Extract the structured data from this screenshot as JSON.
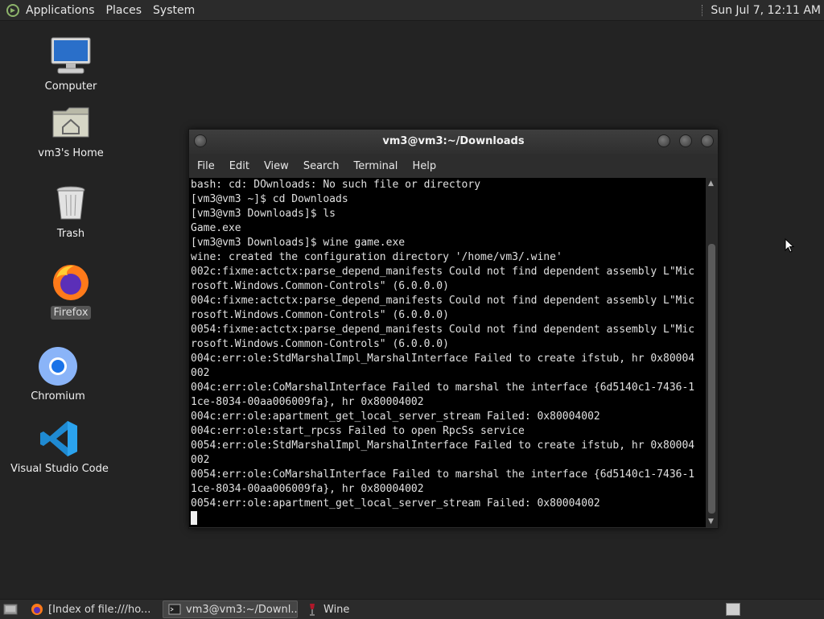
{
  "top_panel": {
    "menus": [
      "Applications",
      "Places",
      "System"
    ],
    "clock": "Sun Jul  7, 12:11 AM"
  },
  "desktop": {
    "icons": [
      {
        "label": "Computer",
        "icon": "computer-icon"
      },
      {
        "label": "vm3's Home",
        "icon": "home-folder-icon"
      },
      {
        "label": "Trash",
        "icon": "trash-icon"
      },
      {
        "label": "Firefox",
        "icon": "firefox-icon",
        "selected": true
      },
      {
        "label": "Chromium",
        "icon": "chromium-icon"
      },
      {
        "label": "Visual Studio Code",
        "icon": "vscode-icon"
      }
    ]
  },
  "terminal": {
    "title": "vm3@vm3:~/Downloads",
    "menu": [
      "File",
      "Edit",
      "View",
      "Search",
      "Terminal",
      "Help"
    ],
    "lines": [
      "bash: cd: DOwnloads: No such file or directory",
      "[vm3@vm3 ~]$ cd Downloads",
      "[vm3@vm3 Downloads]$ ls",
      "Game.exe",
      "[vm3@vm3 Downloads]$ wine game.exe",
      "wine: created the configuration directory '/home/vm3/.wine'",
      "002c:fixme:actctx:parse_depend_manifests Could not find dependent assembly L\"Mic",
      "rosoft.Windows.Common-Controls\" (6.0.0.0)",
      "004c:fixme:actctx:parse_depend_manifests Could not find dependent assembly L\"Mic",
      "rosoft.Windows.Common-Controls\" (6.0.0.0)",
      "0054:fixme:actctx:parse_depend_manifests Could not find dependent assembly L\"Mic",
      "rosoft.Windows.Common-Controls\" (6.0.0.0)",
      "004c:err:ole:StdMarshalImpl_MarshalInterface Failed to create ifstub, hr 0x80004",
      "002",
      "004c:err:ole:CoMarshalInterface Failed to marshal the interface {6d5140c1-7436-1",
      "1ce-8034-00aa006009fa}, hr 0x80004002",
      "004c:err:ole:apartment_get_local_server_stream Failed: 0x80004002",
      "004c:err:ole:start_rpcss Failed to open RpcSs service",
      "0054:err:ole:StdMarshalImpl_MarshalInterface Failed to create ifstub, hr 0x80004",
      "002",
      "0054:err:ole:CoMarshalInterface Failed to marshal the interface {6d5140c1-7436-1",
      "1ce-8034-00aa006009fa}, hr 0x80004002",
      "0054:err:ole:apartment_get_local_server_stream Failed: 0x80004002"
    ]
  },
  "taskbar": {
    "tasks": [
      {
        "label": "[Index of file:///ho...",
        "icon": "firefox-icon"
      },
      {
        "label": "vm3@vm3:~/Downl...",
        "icon": "terminal-icon",
        "active": true
      },
      {
        "label": "Wine",
        "icon": "wine-icon"
      }
    ]
  },
  "colors": {
    "desktop_bg": "#232323",
    "panel_bg": "#2b2b2b",
    "terminal_bg": "#000000",
    "terminal_fg": "#e0e0e0"
  }
}
